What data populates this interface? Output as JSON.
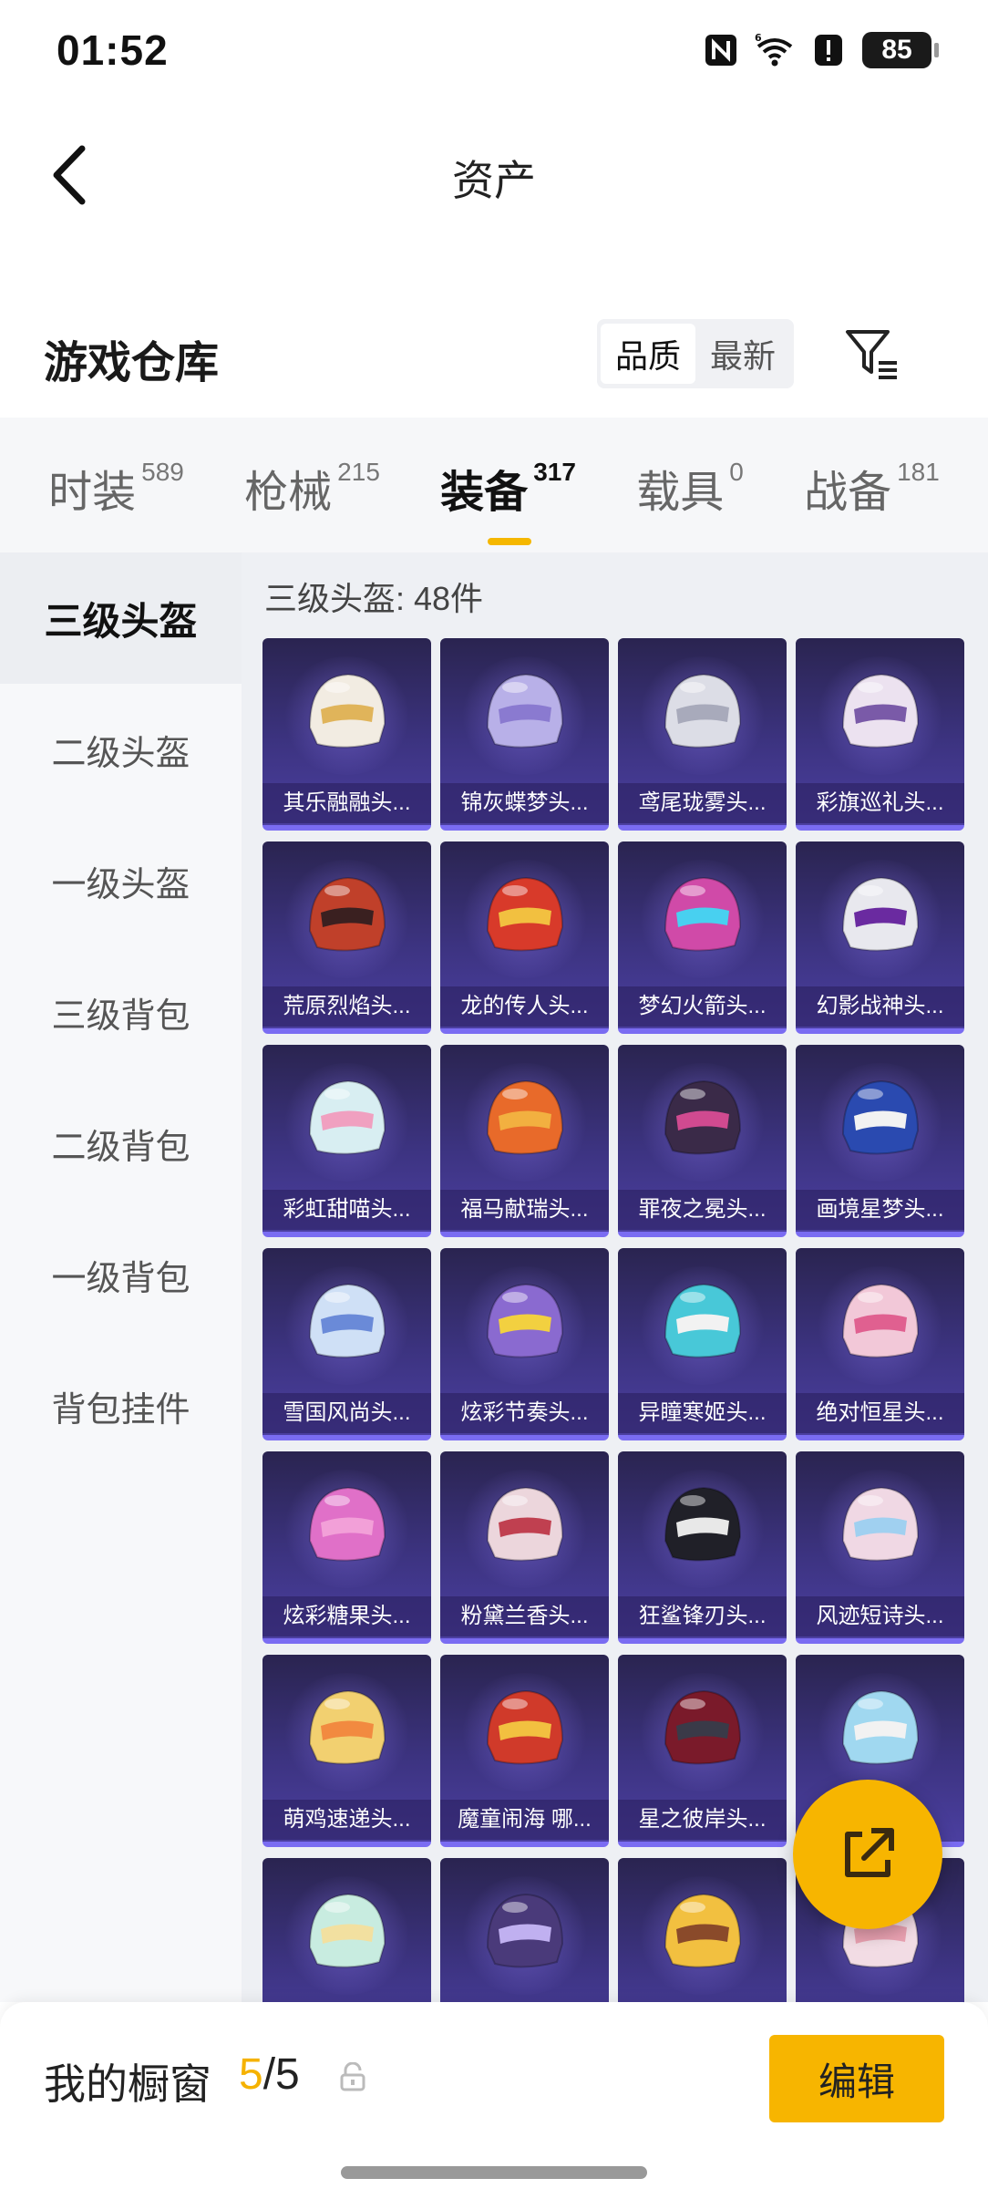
{
  "status_bar": {
    "time": "01:52",
    "battery": "85",
    "icons": [
      "nfc-icon",
      "wifi-6-icon",
      "alert-icon",
      "battery-icon"
    ]
  },
  "header": {
    "title": "资产",
    "back_icon": "chevron-left-icon"
  },
  "section": {
    "title": "游戏仓库",
    "sort_options": [
      "品质",
      "最新"
    ],
    "sort_selected": "品质",
    "filter_icon": "filter-icon"
  },
  "category_tabs": [
    {
      "label": "时装",
      "count": "589"
    },
    {
      "label": "枪械",
      "count": "215"
    },
    {
      "label": "装备",
      "count": "317",
      "active": true
    },
    {
      "label": "载具",
      "count": "0"
    },
    {
      "label": "战备",
      "count": "181"
    }
  ],
  "side_nav": [
    {
      "label": "三级头盔",
      "active": true
    },
    {
      "label": "二级头盔"
    },
    {
      "label": "一级头盔"
    },
    {
      "label": "三级背包"
    },
    {
      "label": "二级背包"
    },
    {
      "label": "一级背包"
    },
    {
      "label": "背包挂件"
    }
  ],
  "list_header": "三级头盔: 48件",
  "items": [
    {
      "name": "其乐融融头...",
      "color": "#f2ece2",
      "accent": "#e0b45a"
    },
    {
      "name": "锦灰蝶梦头...",
      "color": "#b8b0e8",
      "accent": "#8a7ad0"
    },
    {
      "name": "鸢尾珑雾头...",
      "color": "#dcdde6",
      "accent": "#a8aabb"
    },
    {
      "name": "彩旗巡礼头...",
      "color": "#ece2f0",
      "accent": "#7a5aa8"
    },
    {
      "name": "荒原烈焰头...",
      "color": "#c0402a",
      "accent": "#3a2020"
    },
    {
      "name": "龙的传人头...",
      "color": "#d83a2a",
      "accent": "#f2c040"
    },
    {
      "name": "梦幻火箭头...",
      "color": "#d04aa8",
      "accent": "#48d0f0"
    },
    {
      "name": "幻影战神头...",
      "color": "#e8e8ee",
      "accent": "#6a2aa0"
    },
    {
      "name": "彩虹甜喵头...",
      "color": "#d8eef2",
      "accent": "#f0a0c0"
    },
    {
      "name": "福马献瑞头...",
      "color": "#e86a2a",
      "accent": "#f2b040"
    },
    {
      "name": "罪夜之冕头...",
      "color": "#3a2a48",
      "accent": "#d04a90"
    },
    {
      "name": "画境星梦头...",
      "color": "#2a4ab0",
      "accent": "#f2f2f2"
    },
    {
      "name": "雪国风尚头...",
      "color": "#cfe0f6",
      "accent": "#6a8ad8"
    },
    {
      "name": "炫彩节奏头...",
      "color": "#8a6ad0",
      "accent": "#f2d040"
    },
    {
      "name": "异瞳寒姬头...",
      "color": "#48c8d8",
      "accent": "#f2f2f2"
    },
    {
      "name": "绝对恒星头...",
      "color": "#f2c8d8",
      "accent": "#e06090"
    },
    {
      "name": "炫彩糖果头...",
      "color": "#e070c8",
      "accent": "#f2a0d8"
    },
    {
      "name": "粉黛兰香头...",
      "color": "#ecd6dc",
      "accent": "#c04050"
    },
    {
      "name": "狂鲨锋刃头...",
      "color": "#202028",
      "accent": "#e8e8e8"
    },
    {
      "name": "风迹短诗头...",
      "color": "#f0d8e4",
      "accent": "#a0d0f0"
    },
    {
      "name": "萌鸡速递头...",
      "color": "#f2d070",
      "accent": "#f28a40"
    },
    {
      "name": "魔童闹海 哪...",
      "color": "#d03a2a",
      "accent": "#f2c040"
    },
    {
      "name": "星之彼岸头...",
      "color": "#7a1a2a",
      "accent": "#3a3a48"
    },
    {
      "name": "",
      "color": "#a0d8f0",
      "accent": "#f2f2f2"
    },
    {
      "name": "",
      "color": "#c8ece0",
      "accent": "#f2e0a0"
    },
    {
      "name": "",
      "color": "#4a3a7a",
      "accent": "#c0b0f0"
    },
    {
      "name": "",
      "color": "#f2c040",
      "accent": "#8a4a2a"
    },
    {
      "name": "",
      "color": "#f2dce4",
      "accent": "#e8a0b0"
    }
  ],
  "share_fab": {
    "icon": "share-external-icon"
  },
  "bottom_bar": {
    "label": "我的橱窗",
    "count_used": "5",
    "count_sep": "/",
    "count_total": "5",
    "lock_icon": "lock-open-icon",
    "edit_label": "编辑"
  },
  "colors": {
    "accent": "#f5b700",
    "card_bg": "#3c3380"
  }
}
